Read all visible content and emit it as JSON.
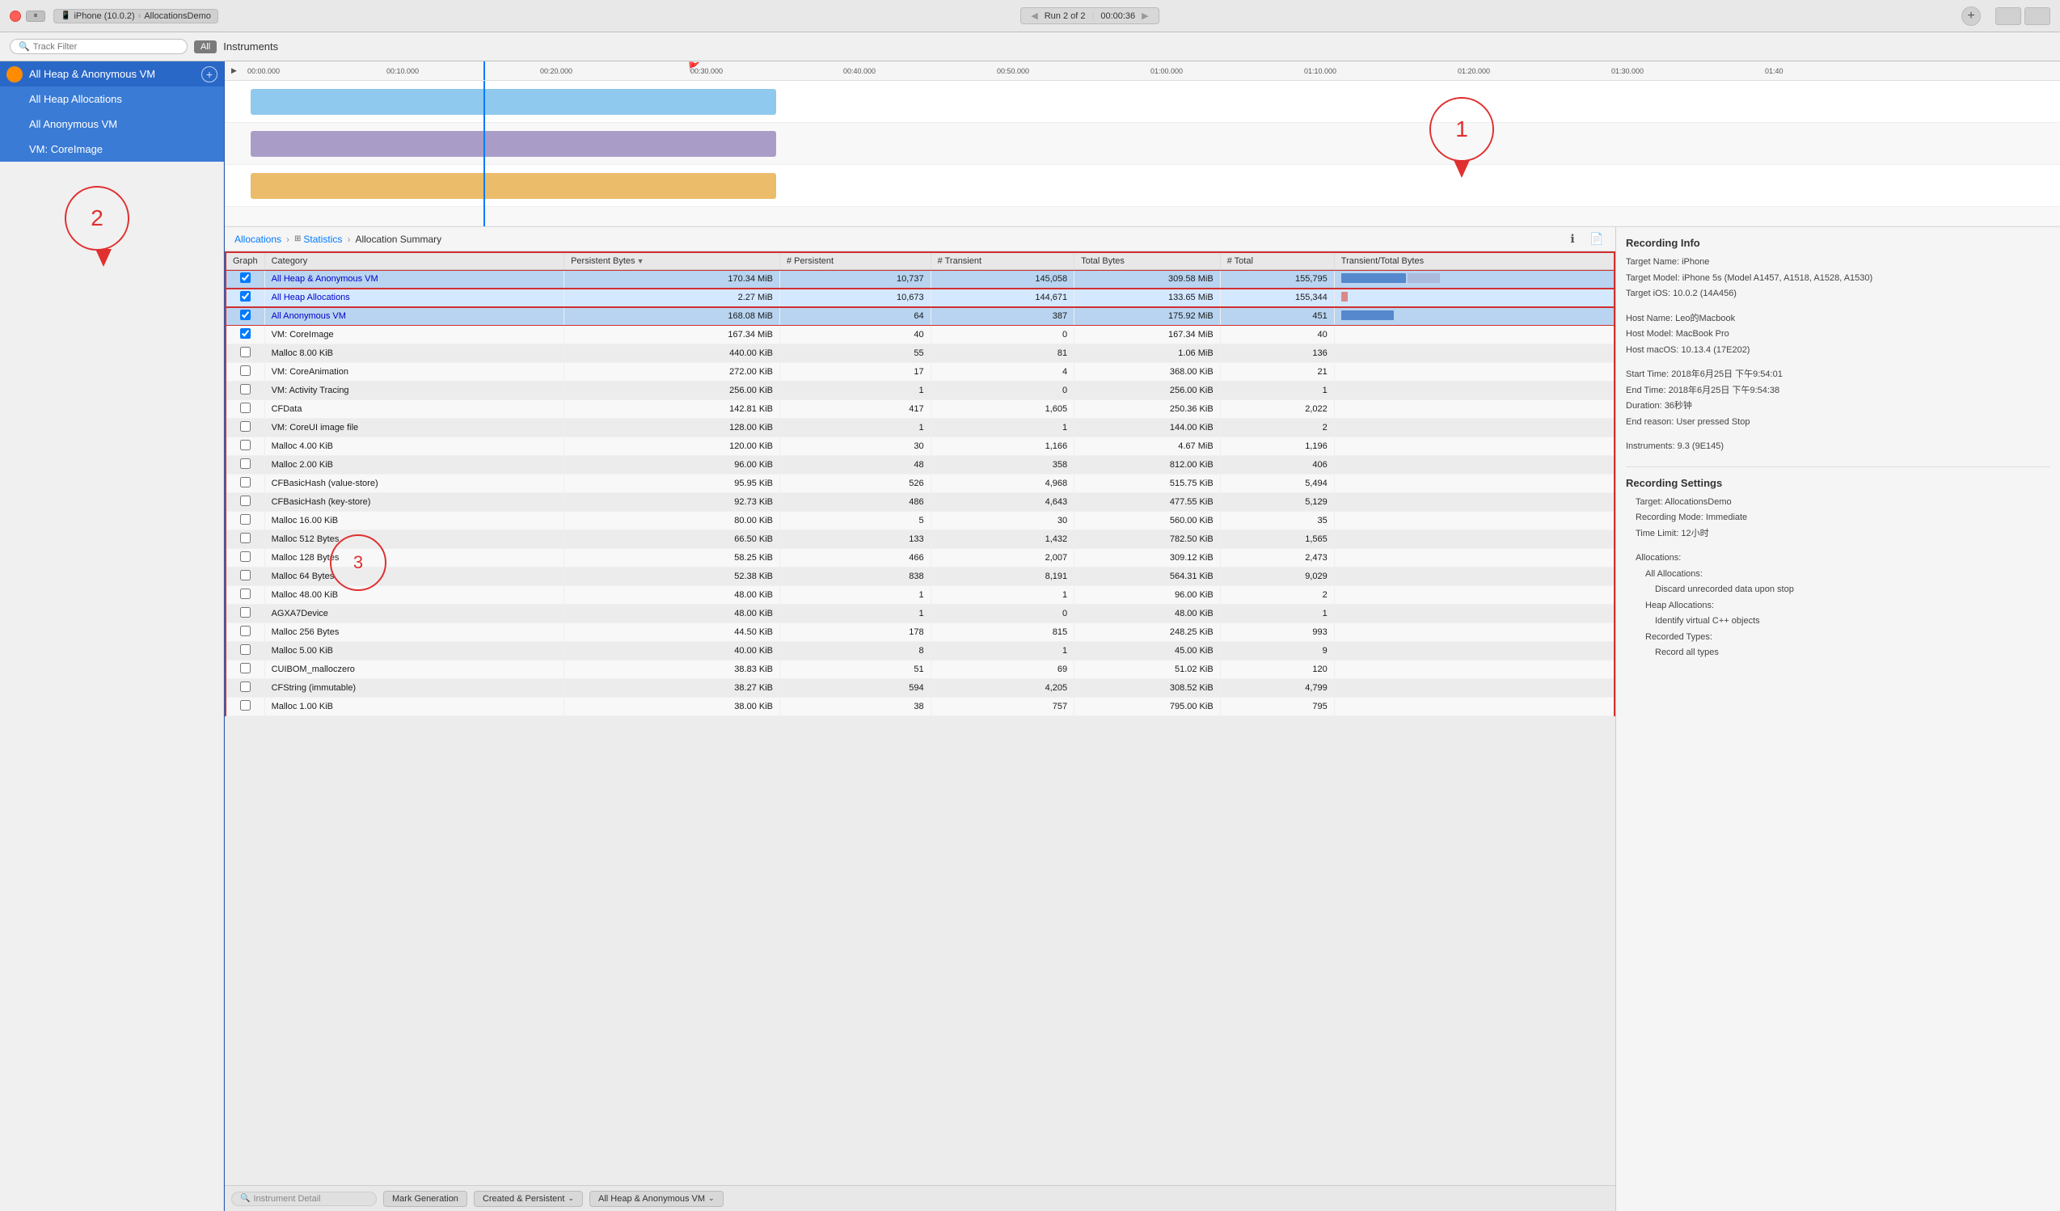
{
  "titlebar": {
    "device": "iPhone (10.0.2)",
    "app": "AllocationsDemo",
    "run_label": "Run 2 of 2",
    "time": "00:00:36",
    "add_btn": "+",
    "pause_icon": "⏸"
  },
  "toolbar": {
    "search_placeholder": "Track Filter",
    "all_label": "All",
    "instruments_label": "Instruments"
  },
  "ruler": {
    "ticks": [
      "00:00.000",
      "00:10.000",
      "00:20.000",
      "00:30.000",
      "00:40.000",
      "00:50.000",
      "01:00.000",
      "01:10.000",
      "01:20.000",
      "01:30.000",
      "01:40"
    ]
  },
  "sidebar": {
    "items": [
      {
        "label": "All Heap & Anonymous VM",
        "icon": true
      },
      {
        "label": "All Heap Allocations",
        "icon": false
      },
      {
        "label": "All Anonymous VM",
        "icon": false
      },
      {
        "label": "VM: CoreImage",
        "icon": false
      }
    ]
  },
  "breadcrumb": {
    "items": [
      "Allocations",
      "Statistics",
      "Allocation Summary"
    ]
  },
  "table": {
    "columns": [
      "Graph",
      "Category",
      "Persistent Bytes",
      "# Persistent",
      "# Transient",
      "Total Bytes",
      "# Total",
      "Transient/Total Bytes"
    ],
    "rows": [
      {
        "graph": true,
        "category": "All Heap & Anonymous VM",
        "persistent_bytes": "170.34 MiB",
        "num_persistent": "10,737",
        "num_transient": "145,058",
        "total_bytes": "309.58 MiB",
        "num_total": "155,795",
        "bar": "blue_wide",
        "highlight": "blue"
      },
      {
        "graph": true,
        "category": "All Heap Allocations",
        "persistent_bytes": "2.27 MiB",
        "num_persistent": "10,673",
        "num_transient": "144,671",
        "total_bytes": "133.65 MiB",
        "num_total": "155,344",
        "bar": "pink_small",
        "highlight": "light_blue"
      },
      {
        "graph": true,
        "category": "All Anonymous VM",
        "persistent_bytes": "168.08 MiB",
        "num_persistent": "64",
        "num_transient": "387",
        "total_bytes": "175.92 MiB",
        "num_total": "451",
        "bar": "blue_med",
        "highlight": "blue"
      },
      {
        "graph": true,
        "category": "VM: CoreImage",
        "persistent_bytes": "167.34 MiB",
        "num_persistent": "40",
        "num_transient": "0",
        "total_bytes": "167.34 MiB",
        "num_total": "40",
        "bar": "",
        "highlight": "white"
      },
      {
        "graph": false,
        "category": "Malloc 8.00 KiB",
        "persistent_bytes": "440.00 KiB",
        "num_persistent": "55",
        "num_transient": "81",
        "total_bytes": "1.06 MiB",
        "num_total": "136",
        "bar": "",
        "highlight": ""
      },
      {
        "graph": false,
        "category": "VM: CoreAnimation",
        "persistent_bytes": "272.00 KiB",
        "num_persistent": "17",
        "num_transient": "4",
        "total_bytes": "368.00 KiB",
        "num_total": "21",
        "bar": "",
        "highlight": ""
      },
      {
        "graph": false,
        "category": "VM: Activity Tracing",
        "persistent_bytes": "256.00 KiB",
        "num_persistent": "1",
        "num_transient": "0",
        "total_bytes": "256.00 KiB",
        "num_total": "1",
        "bar": "",
        "highlight": ""
      },
      {
        "graph": false,
        "category": "CFData",
        "persistent_bytes": "142.81 KiB",
        "num_persistent": "417",
        "num_transient": "1,605",
        "total_bytes": "250.36 KiB",
        "num_total": "2,022",
        "bar": "",
        "highlight": ""
      },
      {
        "graph": false,
        "category": "VM: CoreUI image file",
        "persistent_bytes": "128.00 KiB",
        "num_persistent": "1",
        "num_transient": "1",
        "total_bytes": "144.00 KiB",
        "num_total": "2",
        "bar": "",
        "highlight": ""
      },
      {
        "graph": false,
        "category": "Malloc 4.00 KiB",
        "persistent_bytes": "120.00 KiB",
        "num_persistent": "30",
        "num_transient": "1,166",
        "total_bytes": "4.67 MiB",
        "num_total": "1,196",
        "bar": "",
        "highlight": ""
      },
      {
        "graph": false,
        "category": "Malloc 2.00 KiB",
        "persistent_bytes": "96.00 KiB",
        "num_persistent": "48",
        "num_transient": "358",
        "total_bytes": "812.00 KiB",
        "num_total": "406",
        "bar": "",
        "highlight": ""
      },
      {
        "graph": false,
        "category": "CFBasicHash (value-store)",
        "persistent_bytes": "95.95 KiB",
        "num_persistent": "526",
        "num_transient": "4,968",
        "total_bytes": "515.75 KiB",
        "num_total": "5,494",
        "bar": "",
        "highlight": ""
      },
      {
        "graph": false,
        "category": "CFBasicHash (key-store)",
        "persistent_bytes": "92.73 KiB",
        "num_persistent": "486",
        "num_transient": "4,643",
        "total_bytes": "477.55 KiB",
        "num_total": "5,129",
        "bar": "",
        "highlight": ""
      },
      {
        "graph": false,
        "category": "Malloc 16.00 KiB",
        "persistent_bytes": "80.00 KiB",
        "num_persistent": "5",
        "num_transient": "30",
        "total_bytes": "560.00 KiB",
        "num_total": "35",
        "bar": "",
        "highlight": ""
      },
      {
        "graph": false,
        "category": "Malloc 512 Bytes",
        "persistent_bytes": "66.50 KiB",
        "num_persistent": "133",
        "num_transient": "1,432",
        "total_bytes": "782.50 KiB",
        "num_total": "1,565",
        "bar": "",
        "highlight": ""
      },
      {
        "graph": false,
        "category": "Malloc 128 Bytes",
        "persistent_bytes": "58.25 KiB",
        "num_persistent": "466",
        "num_transient": "2,007",
        "total_bytes": "309.12 KiB",
        "num_total": "2,473",
        "bar": "",
        "highlight": ""
      },
      {
        "graph": false,
        "category": "Malloc 64 Bytes",
        "persistent_bytes": "52.38 KiB",
        "num_persistent": "838",
        "num_transient": "8,191",
        "total_bytes": "564.31 KiB",
        "num_total": "9,029",
        "bar": "",
        "highlight": ""
      },
      {
        "graph": false,
        "category": "Malloc 48.00 KiB",
        "persistent_bytes": "48.00 KiB",
        "num_persistent": "1",
        "num_transient": "1",
        "total_bytes": "96.00 KiB",
        "num_total": "2",
        "bar": "",
        "highlight": ""
      },
      {
        "graph": false,
        "category": "AGXA7Device",
        "persistent_bytes": "48.00 KiB",
        "num_persistent": "1",
        "num_transient": "0",
        "total_bytes": "48.00 KiB",
        "num_total": "1",
        "bar": "",
        "highlight": ""
      },
      {
        "graph": false,
        "category": "Malloc 256 Bytes",
        "persistent_bytes": "44.50 KiB",
        "num_persistent": "178",
        "num_transient": "815",
        "total_bytes": "248.25 KiB",
        "num_total": "993",
        "bar": "",
        "highlight": ""
      },
      {
        "graph": false,
        "category": "Malloc 5.00 KiB",
        "persistent_bytes": "40.00 KiB",
        "num_persistent": "8",
        "num_transient": "1",
        "total_bytes": "45.00 KiB",
        "num_total": "9",
        "bar": "",
        "highlight": ""
      },
      {
        "graph": false,
        "category": "CUIBOM_malloczero",
        "persistent_bytes": "38.83 KiB",
        "num_persistent": "51",
        "num_transient": "69",
        "total_bytes": "51.02 KiB",
        "num_total": "120",
        "bar": "",
        "highlight": ""
      },
      {
        "graph": false,
        "category": "CFString (immutable)",
        "persistent_bytes": "38.27 KiB",
        "num_persistent": "594",
        "num_transient": "4,205",
        "total_bytes": "308.52 KiB",
        "num_total": "4,799",
        "bar": "",
        "highlight": ""
      },
      {
        "graph": false,
        "category": "Malloc 1.00 KiB",
        "persistent_bytes": "38.00 KiB",
        "num_persistent": "38",
        "num_transient": "757",
        "total_bytes": "795.00 KiB",
        "num_total": "795",
        "bar": "",
        "highlight": ""
      }
    ]
  },
  "info_panel": {
    "recording_info_title": "Recording Info",
    "target_name": "Target Name: iPhone",
    "target_model": "Target Model: iPhone 5s (Model A1457, A1518, A1528, A1530)",
    "target_ios": "Target iOS: 10.0.2 (14A456)",
    "blank1": "",
    "host_name": "Host Name: Leo的Macbook",
    "host_model": "Host Model: MacBook Pro",
    "host_macos": "Host macOS: 10.13.4 (17E202)",
    "blank2": "",
    "start_time": "Start Time: 2018年6月25日 下午9:54:01",
    "end_time": "End Time: 2018年6月25日 下午9:54:38",
    "duration": "Duration: 36秒钟",
    "end_reason": "End reason: User pressed Stop",
    "blank3": "",
    "instruments": "Instruments: 9.3 (9E145)",
    "recording_settings_title": "Recording Settings",
    "rs_target": "Target: AllocationsDemo",
    "rs_mode": "Recording Mode: Immediate",
    "rs_timelimit": "Time Limit: 12小时",
    "blank4": "",
    "allocations_label": "Allocations:",
    "all_alloc_label": "All Allocations:",
    "discard_label": "Discard unrecorded data upon stop",
    "heap_alloc_label": "Heap Allocations:",
    "identify_cpp": "Identify virtual C++ objects",
    "recorded_types_label": "Recorded Types:",
    "record_all": "Record all types"
  },
  "bottom_bar": {
    "instrument_detail": "Instrument Detail",
    "mark_generation": "Mark Generation",
    "created_persistent": "Created & Persistent",
    "heap_filter": "All Heap & Anonymous VM"
  },
  "callouts": {
    "c1": "1",
    "c2": "2",
    "c3": "3"
  }
}
